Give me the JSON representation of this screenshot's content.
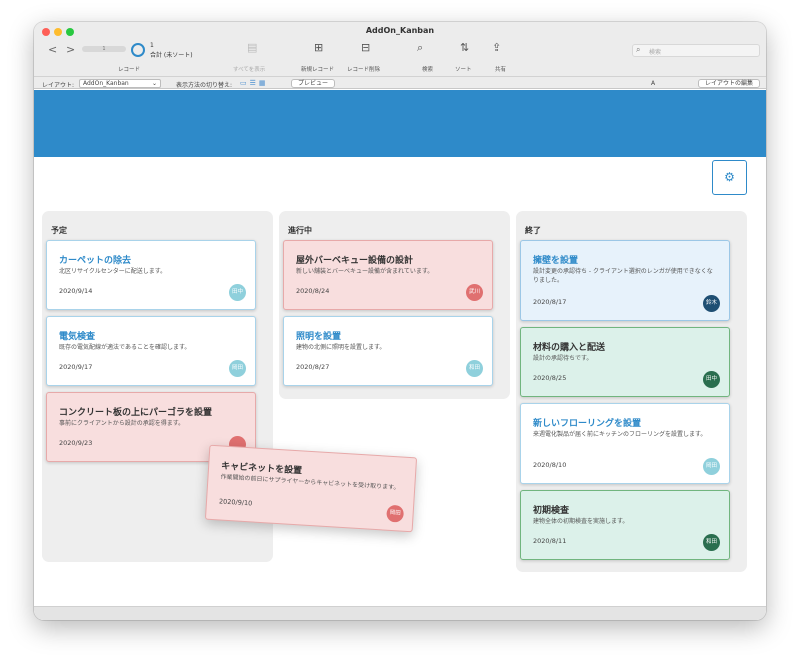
{
  "window": {
    "title": "AddOn_Kanban"
  },
  "toolbar": {
    "nav_prev": "<",
    "nav_next": ">",
    "record_slider_value": "1",
    "record_number": "1",
    "record_total": "合計 (未ソート)",
    "labels": {
      "records": "レコード",
      "show_all": "すべてを表示",
      "new_record": "新規レコード",
      "delete_record": "レコード削除",
      "find": "検索",
      "sort": "ソート",
      "share": "共有"
    },
    "search_placeholder": "検索"
  },
  "layoutbar": {
    "layout_label": "レイアウト:",
    "layout_value": "AddOn_Kanban",
    "view_switch_label": "表示方法の切り替え:",
    "preview_label": "プレビュー",
    "font_size_glyph": "A",
    "edit_layout_label": "レイアウトの編集"
  },
  "colors": {
    "accent": "#2e8ac9",
    "card_pink": "#f8dede",
    "card_green": "#dcf1ea",
    "card_lightblue": "#e7f2fb",
    "avatar_light": "#8fd0dc",
    "avatar_red": "#e07070",
    "avatar_dark": "#1f4f73",
    "avatar_green": "#2a6e4f"
  },
  "columns": [
    {
      "title": "予定",
      "cards": [
        {
          "title": "カーペットの除去",
          "desc": "北区リサイクルセンターに配送します。",
          "date": "2020/9/14",
          "assignee": "田中"
        },
        {
          "title": "電気検査",
          "desc": "既存の電気配線が適法であることを確認します。",
          "date": "2020/9/17",
          "assignee": "岡田"
        },
        {
          "title": "コンクリート板の上にパーゴラを設置",
          "desc": "事前にクライアントから設計の承認を得ます。",
          "date": "2020/9/23",
          "assignee": ""
        }
      ]
    },
    {
      "title": "進行中",
      "cards": [
        {
          "title": "屋外バーベキュー設備の設計",
          "desc": "新しい舗装とバーベキュー設備が含まれています。",
          "date": "2020/8/24",
          "assignee": "武川"
        },
        {
          "title": "照明を設置",
          "desc": "建物の北側に照明を設置します。",
          "date": "2020/8/27",
          "assignee": "和田"
        }
      ]
    },
    {
      "title": "終了",
      "cards": [
        {
          "title": "擁壁を設置",
          "desc": "設計変更の承認待ち - クライアント選択のレンガが使用できなくなりました。",
          "date": "2020/8/17",
          "assignee": "鈴木"
        },
        {
          "title": "材料の購入と配送",
          "desc": "設計の承認待ちです。",
          "date": "2020/8/25",
          "assignee": "田中"
        },
        {
          "title": "新しいフローリングを設置",
          "desc": "来週電化製品が届く前にキッチンのフローリングを設置します。",
          "date": "2020/8/10",
          "assignee": "岡田"
        },
        {
          "title": "初期検査",
          "desc": "建物全体の初期検査を実施します。",
          "date": "2020/8/11",
          "assignee": "和田"
        }
      ]
    }
  ],
  "dragging_card": {
    "title": "キャビネットを設置",
    "desc": "作業開始の前日にサプライヤーからキャビネットを受け取ります。",
    "date": "2020/9/10",
    "assignee": "岡田"
  }
}
